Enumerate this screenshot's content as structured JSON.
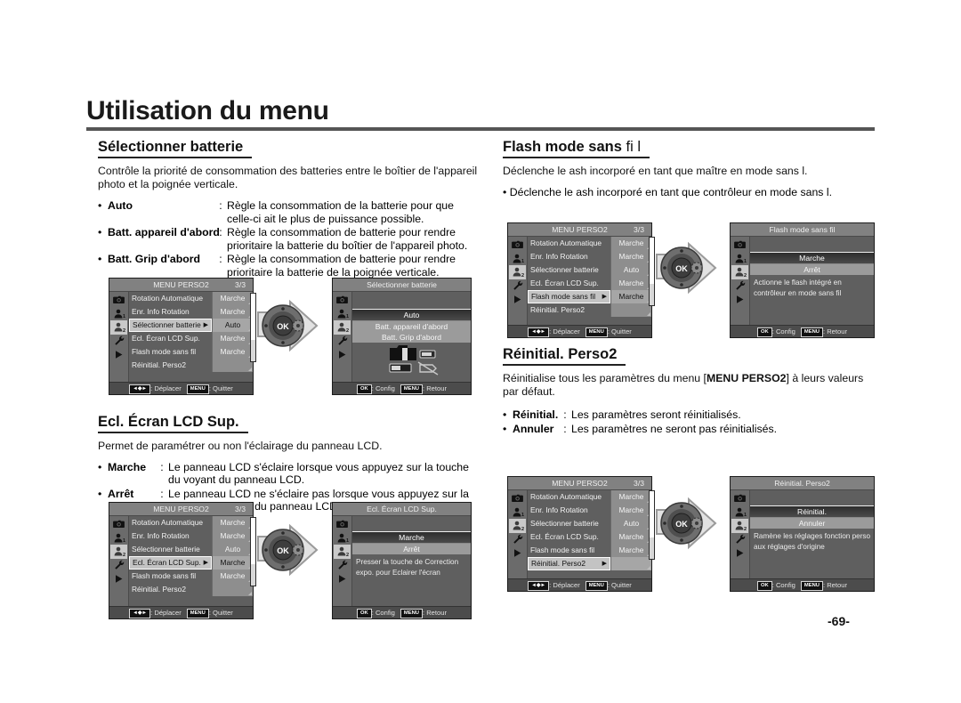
{
  "page": {
    "title": "Utilisation du menu",
    "number": "-69-"
  },
  "sections": {
    "select_battery": {
      "heading": "Sélectionner batterie",
      "description": "Contrôle la priorité de consommation des batteries entre le boîtier de l'appareil photo et la poignée verticale.",
      "items": [
        {
          "bullet": "•",
          "term": "Auto",
          "colon": ":",
          "body": "Règle la consommation de la batterie pour que celle-ci ait le plus de puissance possible."
        },
        {
          "bullet": "•",
          "term": "Batt. appareil d'abord",
          "colon": ":",
          "body": "Règle la consommation de batterie pour rendre prioritaire la batterie du boîtier de l'appareil photo."
        },
        {
          "bullet": "•",
          "term": "Batt. Grip d'abord",
          "colon": ":",
          "body": "Règle la consommation de batterie pour rendre prioritaire la batterie de la poignée verticale."
        }
      ]
    },
    "lcd_panel_light": {
      "heading": "Ecl. Écran LCD Sup.",
      "description": "Permet de paramétrer ou non l'éclairage du panneau LCD.",
      "items": [
        {
          "bullet": "•",
          "term": "Marche",
          "colon": ":",
          "body": "Le panneau LCD s'éclaire lorsque vous appuyez sur la touche du voyant du panneau LCD."
        },
        {
          "bullet": "•",
          "term": "Arrêt",
          "colon": ":",
          "body": "Le panneau LCD ne s'éclaire pas lorsque vous appuyez sur la touche du voyant du panneau LCD"
        }
      ]
    },
    "wireless_flash": {
      "heading_bold": "Flash mode sans",
      "heading_thin": "fi l",
      "description": "Déclenche le  ash incorporé en tant que maître en mode sans  l.",
      "bullet_line": "• Déclenche le  ash incorporé en tant que contrôleur en mode sans  l."
    },
    "reset_perso2": {
      "heading": "Réinitial. Perso2",
      "description_pre": "Réinitialise tous les paramètres du menu [",
      "description_bold": "MENU PERSO2",
      "description_post": "] à leurs valeurs par défaut.",
      "items": [
        {
          "bullet": "•",
          "term": "Réinitial.",
          "colon": ":",
          "body": "Les paramètres seront réinitialisés."
        },
        {
          "bullet": "•",
          "term": "Annuler",
          "colon": ":",
          "body": "Les paramètres ne seront pas réinitialisés."
        }
      ]
    }
  },
  "menu_screen": {
    "title": "MENU PERSO2",
    "page_indicator": "3/3",
    "rows": [
      {
        "label": "Rotation Automatique",
        "value": "Marche"
      },
      {
        "label": "Enr. Info Rotation",
        "value": "Marche"
      },
      {
        "label": "Sélectionner batterie",
        "value": "Auto"
      },
      {
        "label": "Ecl. Écran LCD Sup.",
        "value": "Marche"
      },
      {
        "label": "Flash mode sans fil",
        "value": "Marche"
      },
      {
        "label": "Réinitial. Perso2",
        "value": ""
      }
    ],
    "footer": {
      "key_move": "◄◆►",
      "move_label": ": Déplacer",
      "key_menu": "MENU",
      "menu_label": ": Quitter"
    }
  },
  "detail_footer": {
    "key_ok": "OK",
    "ok_label": ": Config",
    "key_menu": "MENU",
    "menu_label": ": Retour"
  },
  "detail_screens": {
    "select_battery": {
      "title": "Sélectionner batterie",
      "options": [
        "Auto",
        "Batt. appareil d'abord",
        "Batt. Grip d'abord"
      ],
      "selected": "Auto"
    },
    "wireless_flash": {
      "title": "Flash mode sans fil",
      "options": [
        "Marche",
        "Arrêt"
      ],
      "selected": "Marche",
      "note": "Actionne le flash intégré en contrôleur en mode sans fil"
    },
    "lcd_panel_light": {
      "title": "Ecl. Écran LCD Sup.",
      "options": [
        "Marche",
        "Arrêt"
      ],
      "selected": "Marche",
      "note": "Presser la touche de Correction expo. pour  Eclairer l'écran"
    },
    "reset_perso2": {
      "title": "Réinitial. Perso2",
      "options": [
        "Réinitial.",
        "Annuler"
      ],
      "selected": "Réinitial.",
      "note": "Ramène les réglages fonction perso aux réglages d'origine"
    }
  },
  "rail_icons": [
    "camera-icon",
    "person-1-icon",
    "person-2-icon",
    "wrench-icon",
    "play-icon"
  ],
  "dial": {
    "ok_label": "OK"
  }
}
